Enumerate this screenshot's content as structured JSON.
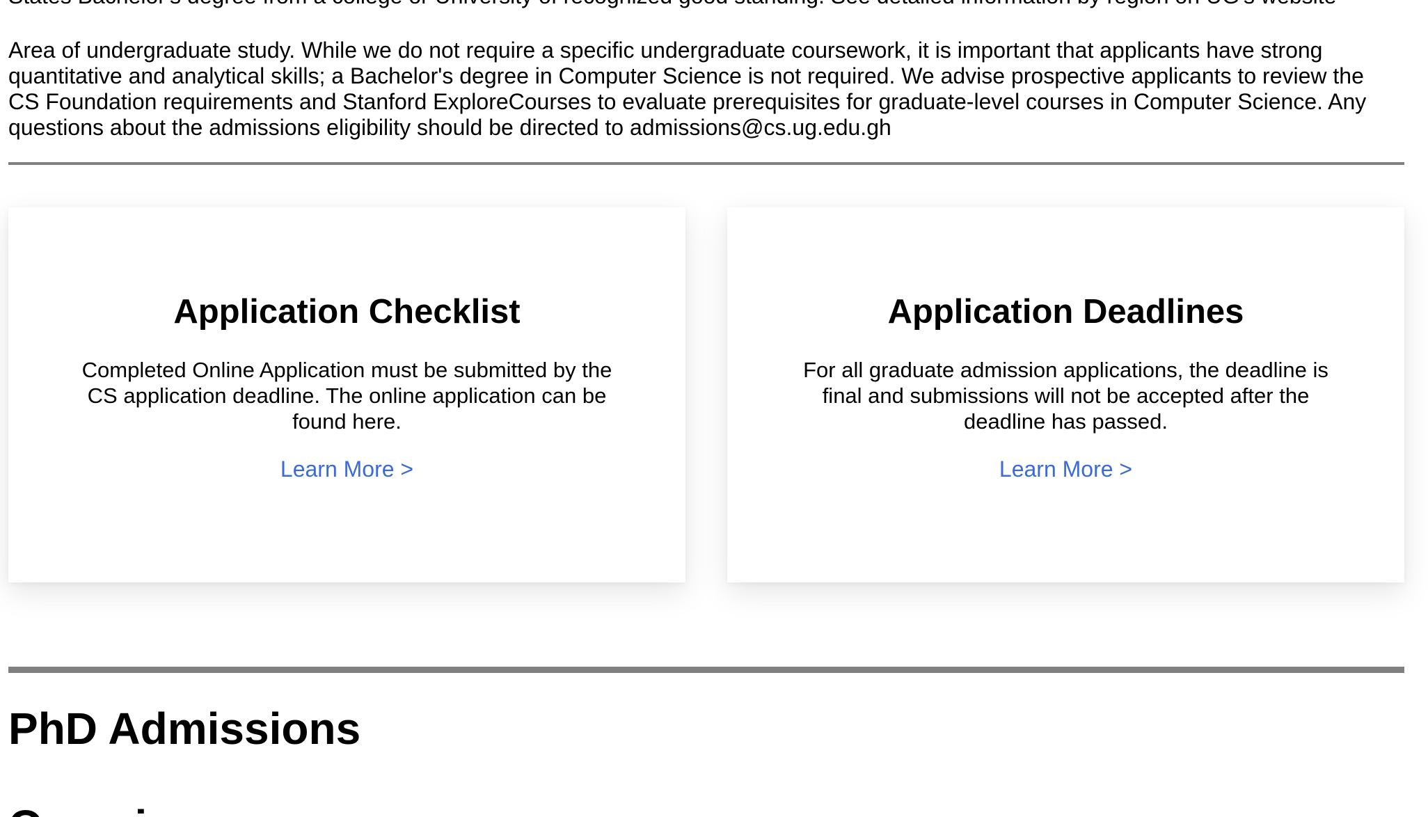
{
  "intro": {
    "cutoff_line": "States Bachelor's degree from a college or University of recognized good standing. See detailed information by region on UG's website",
    "paragraph": "Area of undergraduate study. While we do not require a specific undergraduate coursework, it is important that applicants have strong quantitative and analytical skills; a Bachelor's degree in Computer Science is not required. We advise prospective applicants to review the CS Foundation requirements and Stanford ExploreCourses to evaluate prerequisites for graduate-level courses in Computer Science. Any questions about the admissions eligibility should be directed to admissions@cs.ug.edu.gh"
  },
  "cards": [
    {
      "title": "Application Checklist",
      "body": "Completed Online Application must be submitted by the CS application deadline. The online application can be found here.",
      "link": "Learn More >"
    },
    {
      "title": "Application Deadlines",
      "body": "For all graduate admission applications, the deadline is final and submissions will not be accepted after the deadline has passed.",
      "link": "Learn More >"
    }
  ],
  "phd": {
    "title": "PhD Admissions",
    "subtitle_cutoff": "Overview"
  },
  "colors": {
    "link": "#3b6bd8",
    "rule": "#808080"
  }
}
